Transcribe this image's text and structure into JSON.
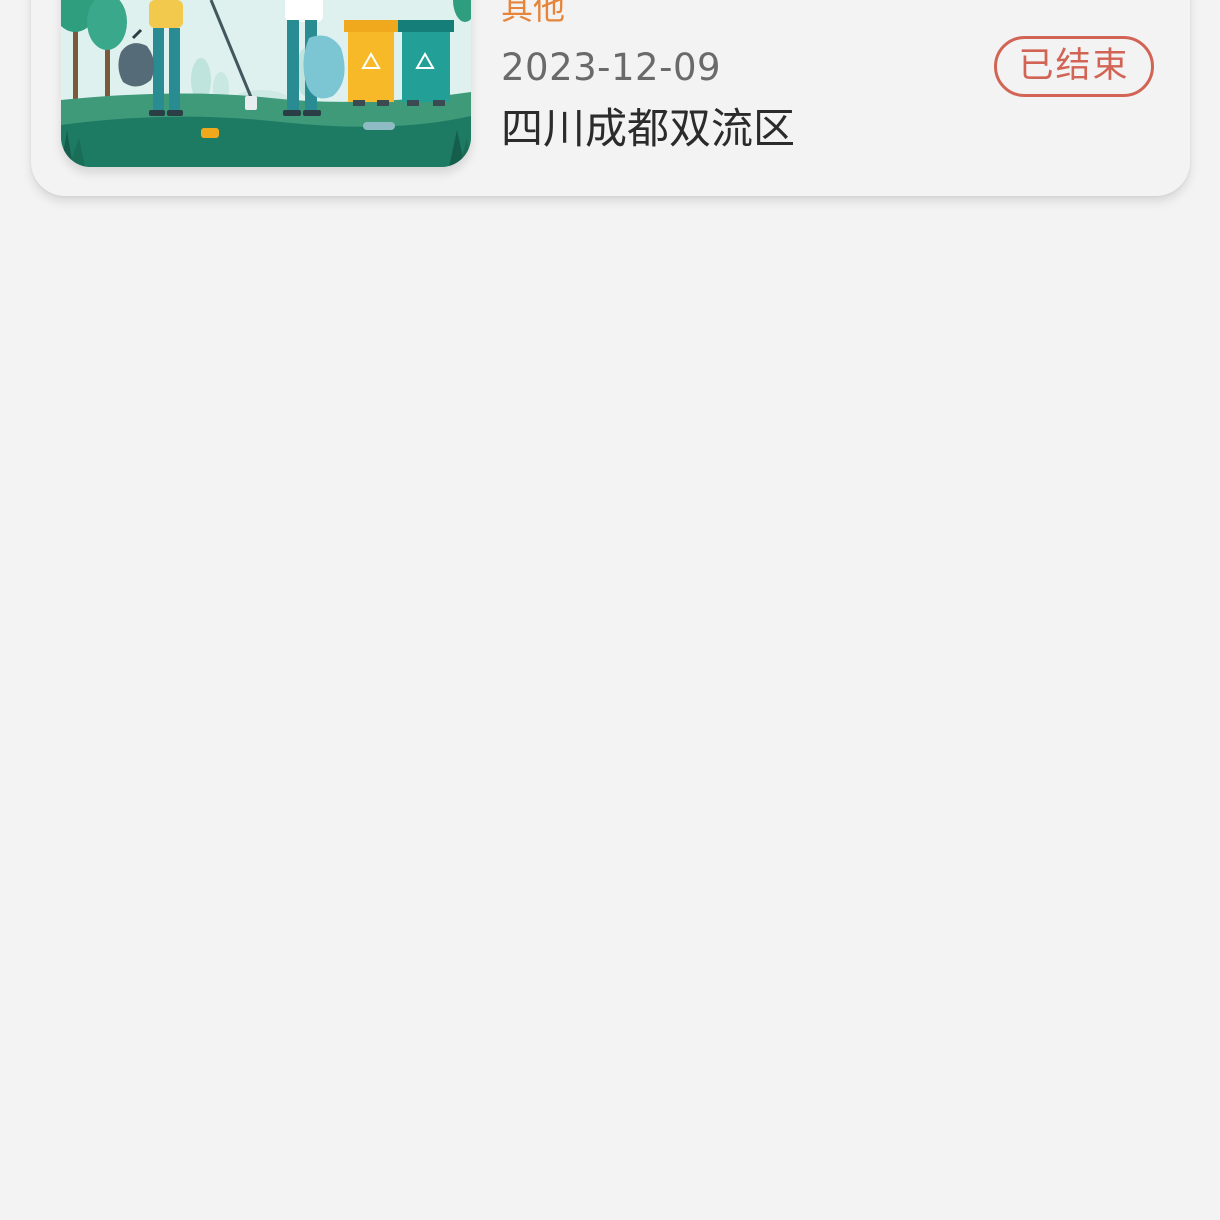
{
  "activity_card": {
    "category": "其他",
    "date": "2023-12-09",
    "location": "四川成都双流区",
    "status": "已结束",
    "image_icon": "volunteers-cleanup-illustration",
    "colors": {
      "category": "#e6853a",
      "status": "#d26455",
      "background": "#f3f3f3"
    }
  }
}
